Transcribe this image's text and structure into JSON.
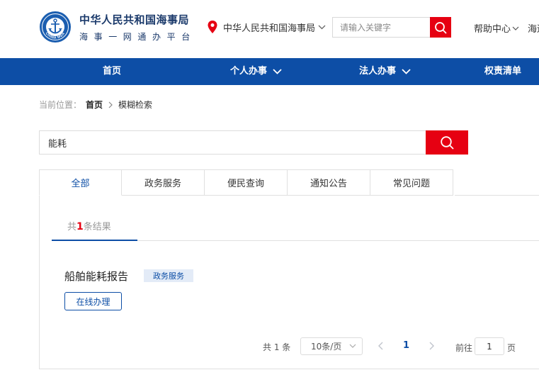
{
  "header": {
    "site_title": "中华人民共和国海事局",
    "site_subtitle": "海事一网通办平台",
    "logo_icon": "msa-emblem-icon",
    "logo_text": "CHINA MSA",
    "location": "中华人民共和国海事局",
    "search_placeholder": "请输入关键字",
    "help_label": "帮助中心",
    "more_label": "海运"
  },
  "nav": {
    "items": [
      {
        "label": "首页",
        "has_dropdown": false
      },
      {
        "label": "个人办事",
        "has_dropdown": true
      },
      {
        "label": "法人办事",
        "has_dropdown": true
      },
      {
        "label": "权责清单",
        "has_dropdown": false
      }
    ]
  },
  "breadcrumb": {
    "label": "当前位置：",
    "home": "首页",
    "current": "模糊检索"
  },
  "search": {
    "value": "能耗"
  },
  "tabs": [
    {
      "label": "全部",
      "active": true
    },
    {
      "label": "政务服务",
      "active": false
    },
    {
      "label": "便民查询",
      "active": false
    },
    {
      "label": "通知公告",
      "active": false
    },
    {
      "label": "常见问题",
      "active": false
    }
  ],
  "results": {
    "count_prefix": "共",
    "count": "1",
    "count_suffix": "条结果",
    "items": [
      {
        "title": "船舶能耗报告",
        "tag": "政务服务",
        "action": "在线办理"
      }
    ]
  },
  "pagination": {
    "total": "共 1 条",
    "page_size": "10条/页",
    "current_page": "1",
    "goto_label": "前往",
    "goto_value": "1",
    "goto_unit": "页"
  },
  "colors": {
    "brand_blue": "#0d4ea6",
    "accent_red": "#e60012"
  }
}
